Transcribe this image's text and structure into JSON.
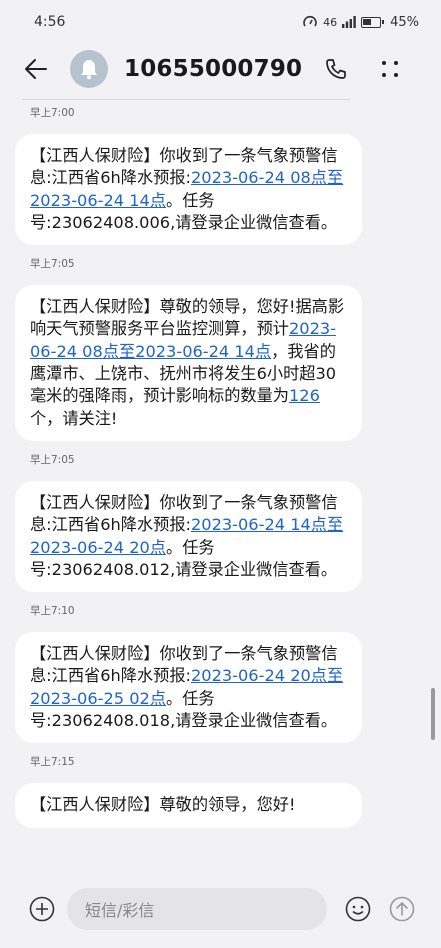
{
  "status": {
    "time": "4:56",
    "signal": "46",
    "battery": "45%"
  },
  "header": {
    "title": "10655000790..."
  },
  "messages": [
    {
      "time": "早上7:00"
    },
    {
      "parts": [
        "【江西人保财险】你收到了一条气象预警信息:江西省6h降水预报:",
        "2023-06-24 08点至2023-06-24 14点",
        "。任务号:23062408.006,请登录企业微信查看。"
      ]
    },
    {
      "time": "早上7:05"
    },
    {
      "parts": [
        "【江西人保财险】尊敬的领导，您好!据高影响天气预警服务平台监控测算，预计",
        "2023-06-24 08点至2023-06-24 14点",
        "，我省的鹰潭市、上饶市、抚州市将发生6小时超30毫米的强降雨，预计影响标的数量为",
        "126",
        "个，请关注!"
      ]
    },
    {
      "time": "早上7:05"
    },
    {
      "parts": [
        "【江西人保财险】你收到了一条气象预警信息:江西省6h降水预报:",
        "2023-06-24 14点至2023-06-24 20点",
        "。任务号:23062408.012,请登录企业微信查看。"
      ]
    },
    {
      "time": "早上7:10"
    },
    {
      "parts": [
        "【江西人保财险】你收到了一条气象预警信息:江西省6h降水预报:",
        "2023-06-24 20点至2023-06-25 02点",
        "。任务号:23062408.018,请登录企业微信查看。"
      ]
    },
    {
      "time": "早上7:15"
    },
    {
      "parts": [
        "【江西人保财险】尊敬的领导，您好!"
      ]
    }
  ],
  "compose": {
    "placeholder": "短信/彩信"
  }
}
